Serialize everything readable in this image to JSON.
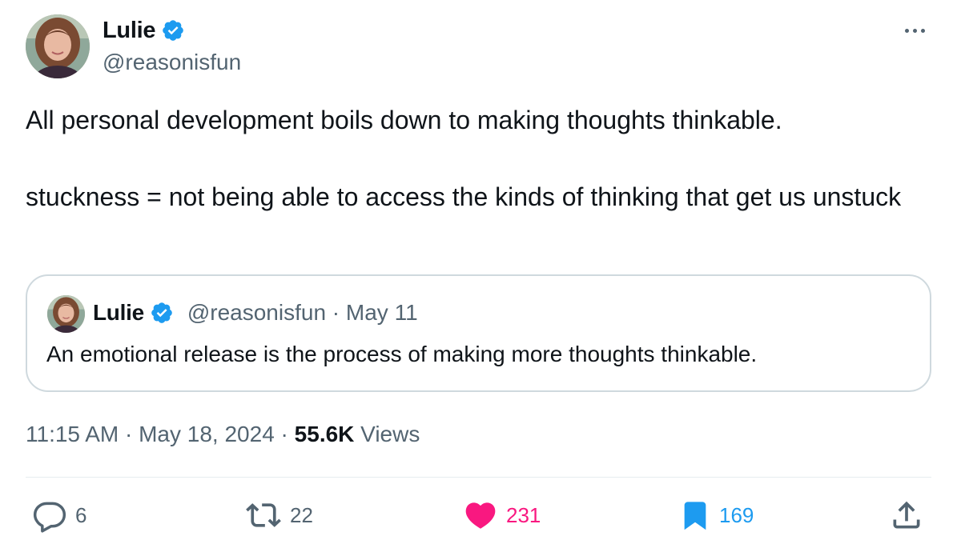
{
  "author": {
    "name": "Lulie",
    "handle": "@reasonisfun",
    "verified": true
  },
  "tweet": {
    "lines": [
      "All personal development boils down to making thoughts thinkable.",
      "stuckness = not being able to access the kinds of thinking that get us unstuck"
    ]
  },
  "quote": {
    "name": "Lulie",
    "meta": "@reasonisfun · May 11",
    "text": "An emotional release is the process of making more thoughts thinkable."
  },
  "meta": {
    "timestamp": "11:15 AM · May 18, 2024 · ",
    "views_count": "55.6K",
    "views_label": " Views"
  },
  "actions": {
    "replies": "6",
    "retweets": "22",
    "likes": "231",
    "bookmarks": "169"
  },
  "colors": {
    "verified": "#1d9bf0",
    "like": "#f91880",
    "bookmark": "#1d9bf0",
    "secondary_text": "#536471"
  },
  "icons": {
    "more": "more-horizontal-icon",
    "reply": "reply-icon",
    "retweet": "retweet-icon",
    "like": "heart-icon",
    "bookmark": "bookmark-icon",
    "share": "share-icon",
    "verified": "verified-badge-icon"
  }
}
